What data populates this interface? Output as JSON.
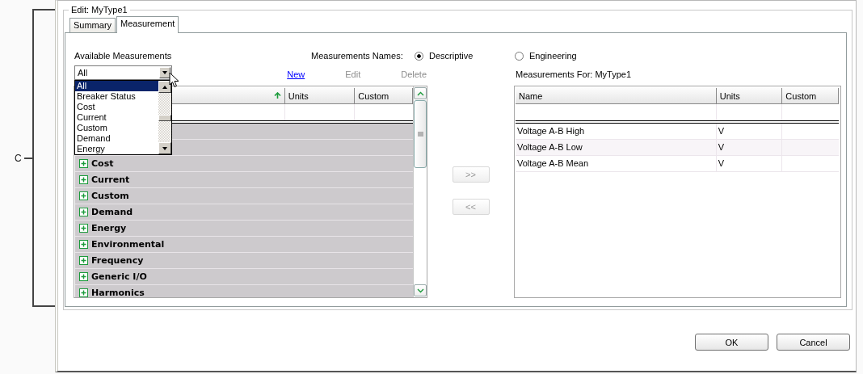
{
  "annotation": {
    "label": "C"
  },
  "dialog": {
    "group_title": "Edit: MyType1",
    "tabs": [
      {
        "label": "Summary",
        "selected": false
      },
      {
        "label": "Measurement",
        "selected": true
      }
    ],
    "available": {
      "label": "Available Measurements",
      "combo_value": "All",
      "dropdown_items": [
        {
          "label": "All",
          "selected": true
        },
        {
          "label": "Breaker Status",
          "selected": false
        },
        {
          "label": "Cost",
          "selected": false
        },
        {
          "label": "Current",
          "selected": false
        },
        {
          "label": "Custom",
          "selected": false
        },
        {
          "label": "Demand",
          "selected": false
        },
        {
          "label": "Energy",
          "selected": false
        }
      ],
      "actions": [
        {
          "label": "New",
          "disabled": false
        },
        {
          "label": "Edit",
          "disabled": true
        },
        {
          "label": "Delete",
          "disabled": true
        }
      ],
      "columns": [
        "Units",
        "Custom"
      ],
      "groups": [
        {
          "label": "Cost",
          "expanded": false
        },
        {
          "label": "Current",
          "expanded": false
        },
        {
          "label": "Custom",
          "expanded": false
        },
        {
          "label": "Demand",
          "expanded": false
        },
        {
          "label": "Energy",
          "expanded": false
        },
        {
          "label": "Environmental",
          "expanded": false
        },
        {
          "label": "Frequency",
          "expanded": false
        },
        {
          "label": "Generic I/O",
          "expanded": false
        },
        {
          "label": "Harmonics",
          "expanded": false
        }
      ]
    },
    "names_option": {
      "label": "Measurements Names:",
      "options": [
        {
          "label": "Descriptive",
          "selected": true
        },
        {
          "label": "Engineering",
          "selected": false
        }
      ]
    },
    "transfer_buttons": [
      {
        "label": ">>",
        "disabled": true
      },
      {
        "label": "<<",
        "disabled": true
      }
    ],
    "selected_panel": {
      "title": "Measurements For: MyType1",
      "columns": [
        "Name",
        "Units",
        "Custom"
      ],
      "rows": [
        {
          "name": "Voltage A-B High",
          "units": "V"
        },
        {
          "name": "Voltage A-B Low",
          "units": "V"
        },
        {
          "name": "Voltage A-B Mean",
          "units": "V"
        }
      ]
    },
    "buttons": [
      "OK",
      "Cancel"
    ]
  }
}
